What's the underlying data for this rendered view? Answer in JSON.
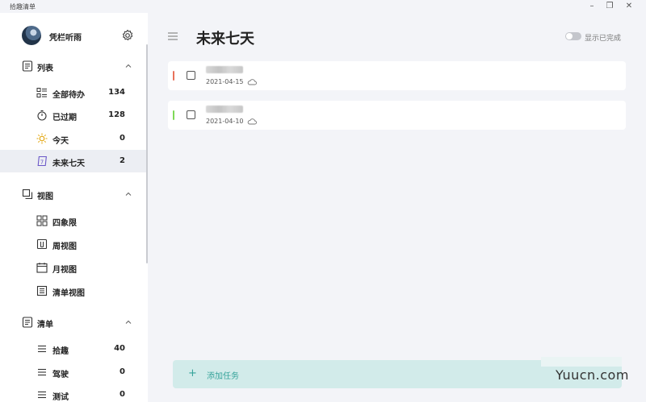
{
  "window": {
    "title": "拾趣清单",
    "minimize": "–",
    "restore": "❐",
    "close": "✕"
  },
  "sidebar": {
    "user": {
      "name": "凭栏听雨"
    },
    "sections": [
      {
        "label": "列表",
        "items": [
          {
            "label": "全部待办",
            "count": "134",
            "icon": "all-tasks-icon"
          },
          {
            "label": "已过期",
            "count": "128",
            "icon": "stopwatch-icon"
          },
          {
            "label": "今天",
            "count": "0",
            "icon": "sun-icon"
          },
          {
            "label": "未来七天",
            "count": "2",
            "icon": "calendar-seven-icon",
            "active": true
          }
        ]
      },
      {
        "label": "视图",
        "items": [
          {
            "label": "四象限",
            "icon": "quadrant-icon"
          },
          {
            "label": "周视图",
            "icon": "week-view-icon"
          },
          {
            "label": "月视图",
            "icon": "month-view-icon"
          },
          {
            "label": "清单视图",
            "icon": "list-view-icon"
          }
        ]
      },
      {
        "label": "清单",
        "items": [
          {
            "label": "拾趣",
            "count": "40",
            "icon": "list-lines-icon"
          },
          {
            "label": "驾驶",
            "count": "0",
            "icon": "list-lines-icon"
          },
          {
            "label": "测试",
            "count": "0",
            "icon": "list-lines-icon"
          }
        ]
      }
    ]
  },
  "main": {
    "title": "未来七天",
    "show_completed_label": "显示已完成",
    "show_completed_on": false,
    "tasks": [
      {
        "date": "2021-04-15",
        "priority_color": "#e8715a"
      },
      {
        "date": "2021-04-10",
        "priority_color": "#7ed957"
      }
    ],
    "add_task": {
      "plus": "+",
      "label": "添加任务"
    }
  },
  "watermark": "Yuucn.com",
  "colors": {
    "accent": "#35a39a",
    "add_bar_bg": "#d2ebea",
    "active_item_bg": "#eceef3"
  }
}
